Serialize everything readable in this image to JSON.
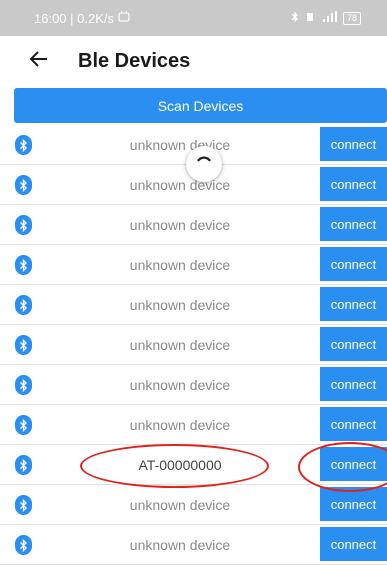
{
  "status_bar": {
    "time_speed": "16:00 | 0.2K/s",
    "left_icon": "notification-icon",
    "right_icons": [
      "bluetooth-icon",
      "vibrate-icon",
      "signal-icon"
    ],
    "battery": "78"
  },
  "app_bar": {
    "title": "Ble Devices",
    "back_icon": "arrow-left-icon"
  },
  "scan_button": {
    "label": "Scan Devices"
  },
  "devices": [
    {
      "name": "unknown device",
      "connect_label": "connect"
    },
    {
      "name": "unknown device",
      "connect_label": "connect"
    },
    {
      "name": "unknown device",
      "connect_label": "connect"
    },
    {
      "name": "unknown device",
      "connect_label": "connect"
    },
    {
      "name": "unknown device",
      "connect_label": "connect"
    },
    {
      "name": "unknown device",
      "connect_label": "connect"
    },
    {
      "name": "unknown device",
      "connect_label": "connect"
    },
    {
      "name": "unknown device",
      "connect_label": "connect"
    },
    {
      "name": "AT-00000000",
      "connect_label": "connect"
    },
    {
      "name": "unknown device",
      "connect_label": "connect"
    },
    {
      "name": "unknown device",
      "connect_label": "connect"
    }
  ],
  "colors": {
    "accent": "#2b8ef1",
    "status_bar": "#c9c9c9",
    "annotation": "#e0231d"
  }
}
